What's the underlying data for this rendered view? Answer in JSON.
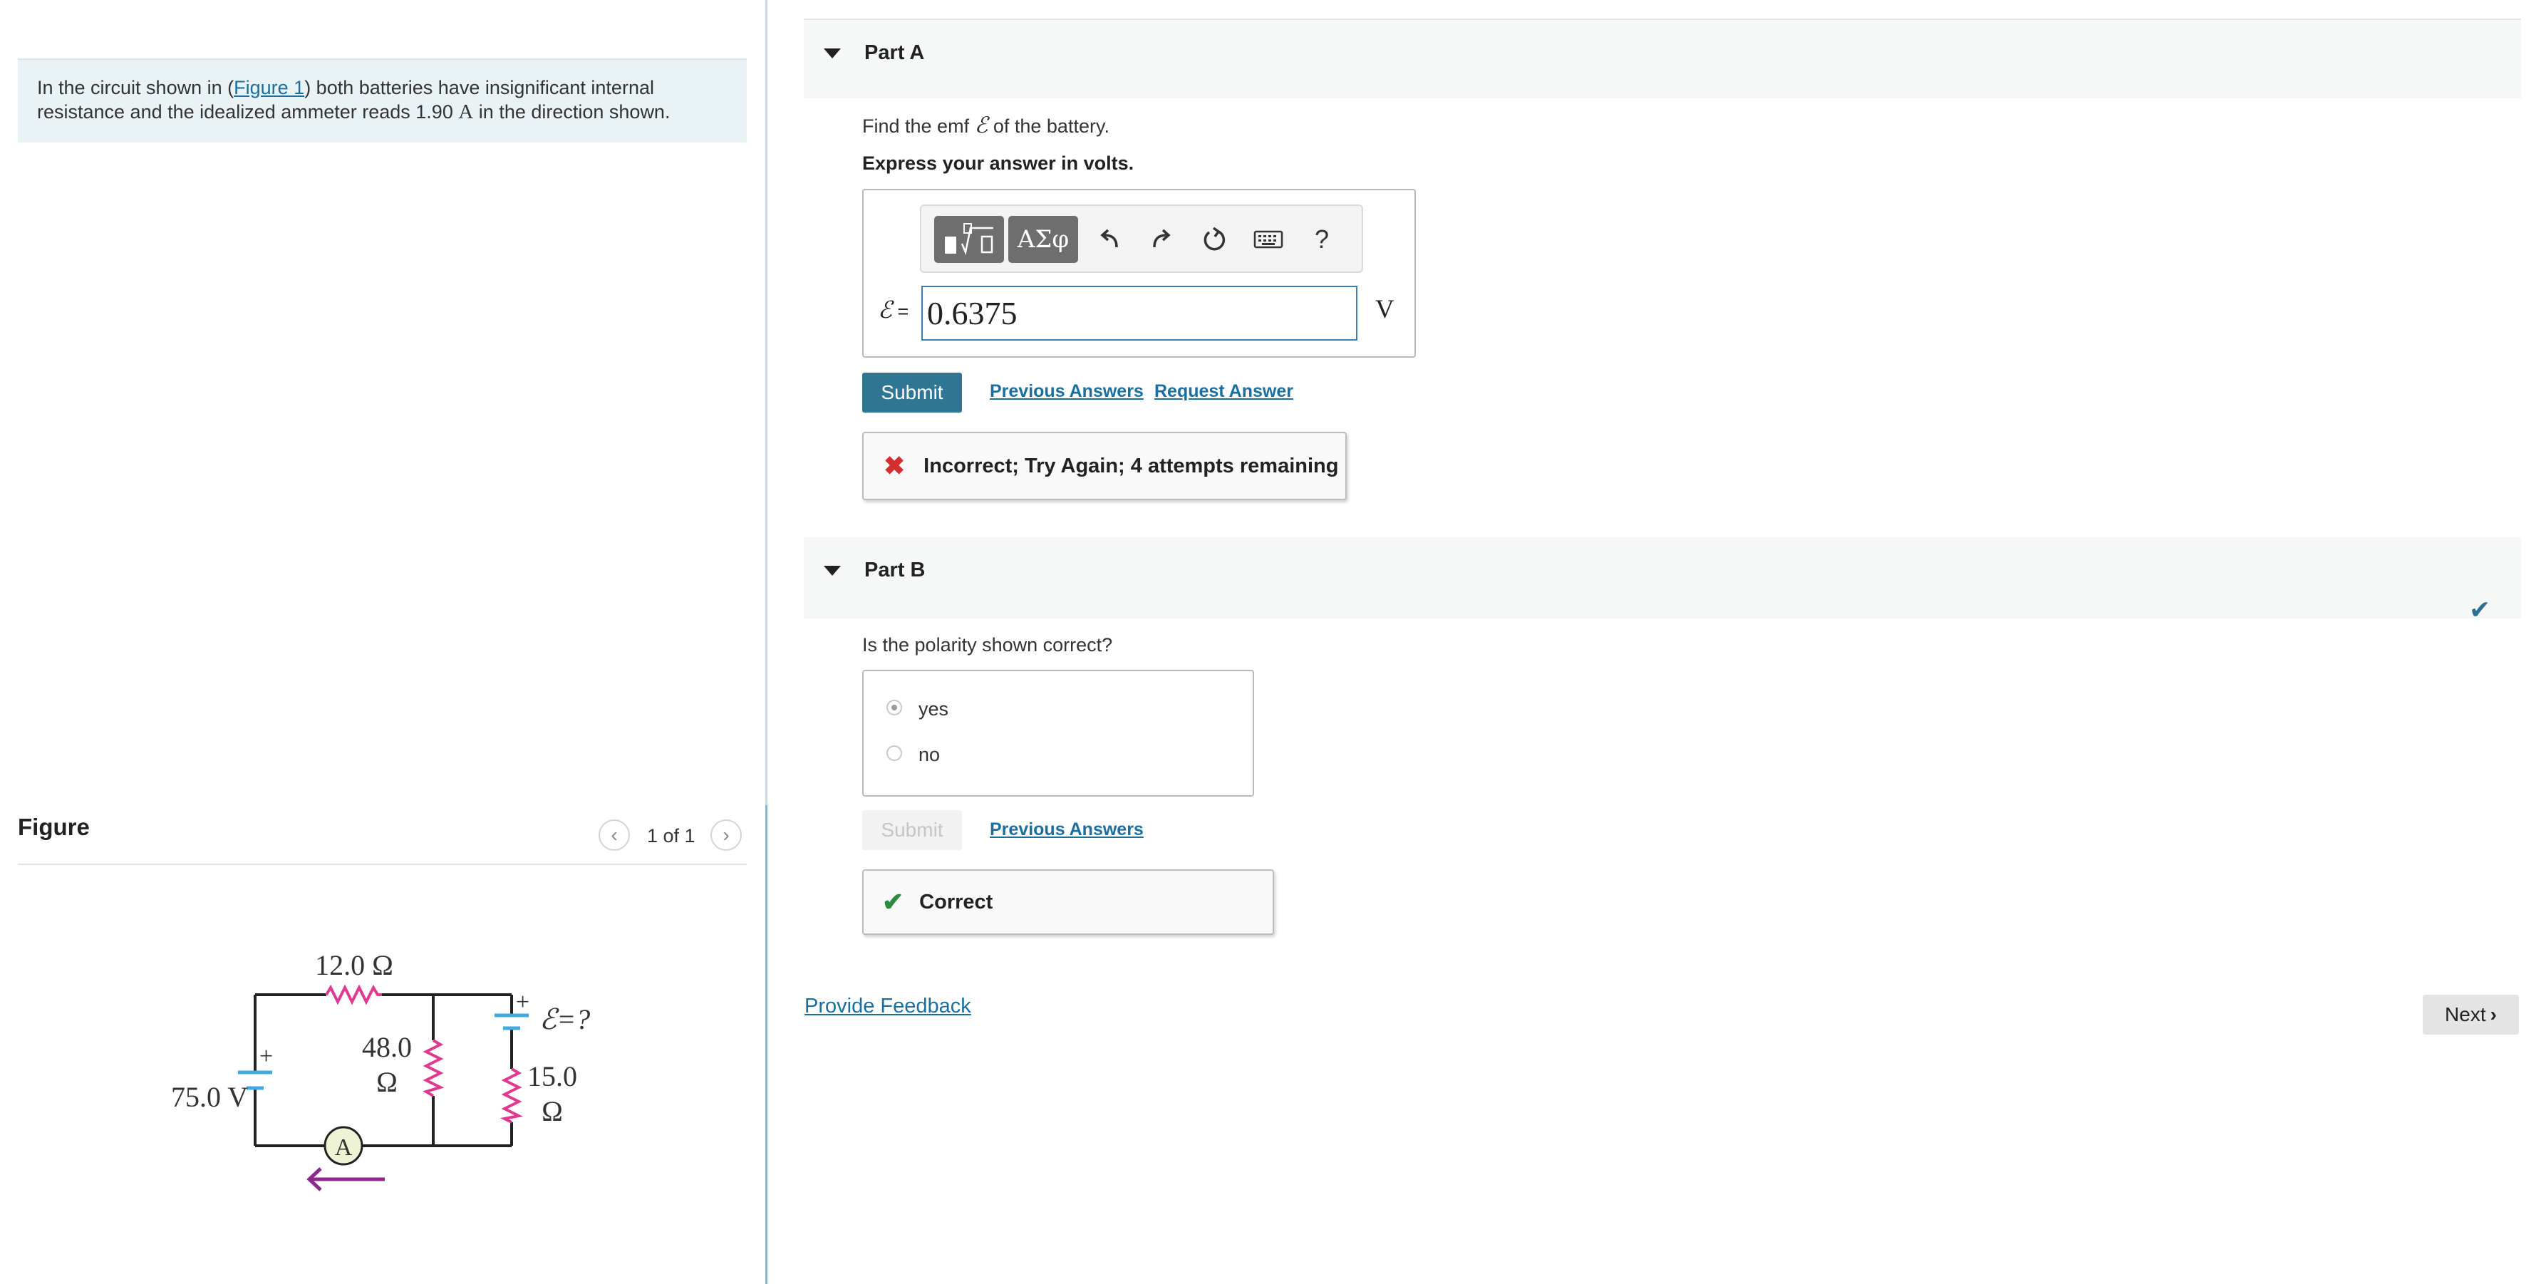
{
  "problem": {
    "text_before": "In the circuit shown in (",
    "figure_link": "Figure 1",
    "text_after": ") both batteries have insignificant internal resistance and the idealized ammeter reads 1.90 ",
    "unit": "A",
    "text_end": " in the direction shown."
  },
  "figure_panel": {
    "heading": "Figure",
    "counter": "1 of 1",
    "circuit": {
      "r_top": "12.0 Ω",
      "r_mid_value": "48.0",
      "r_mid_unit": "Ω",
      "r_right_value": "15.0",
      "r_right_unit": "Ω",
      "battery_left": "75.0 V",
      "battery_right": "ℰ=?",
      "plus_left": "+",
      "plus_right": "+",
      "ammeter": "A"
    }
  },
  "part_a": {
    "title": "Part A",
    "question_before": "Find the emf ",
    "question_symbol": "ℰ",
    "question_after": " of the battery.",
    "instruction": "Express your answer in volts.",
    "toolbar": {
      "greek_label": "ΑΣφ",
      "help_label": "?"
    },
    "equation_symbol": "ℰ",
    "equation_equals": " =",
    "answer_value": "0.6375",
    "unit": "V",
    "submit_label": "Submit",
    "previous_answers_label": "Previous Answers",
    "request_answer_label": "Request Answer",
    "feedback": "Incorrect; Try Again; 4 attempts remaining"
  },
  "part_b": {
    "title": "Part B",
    "question": "Is the polarity shown correct?",
    "options": [
      "yes",
      "no"
    ],
    "selected": "yes",
    "submit_label": "Submit",
    "previous_answers_label": "Previous Answers",
    "feedback": "Correct"
  },
  "footer": {
    "provide_feedback_label": "Provide Feedback",
    "next_label": "Next"
  },
  "colors": {
    "link": "#1a6fa0",
    "submit_active": "#2f7694",
    "error": "#d32f2f",
    "success": "#2e8b3d",
    "resistor": "#e0398f",
    "battery": "#3fa9e0",
    "arrow": "#8b2a8a"
  }
}
